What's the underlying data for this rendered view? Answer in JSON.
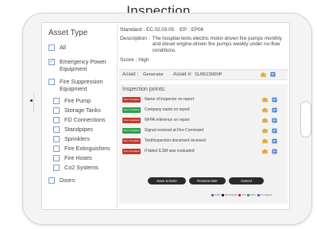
{
  "page_title": "Inspection",
  "sidebar": {
    "title": "Asset Type",
    "items": [
      {
        "label": "All",
        "checked": false
      },
      {
        "label": "Emergency Power Equipment",
        "checked": true
      },
      {
        "label": "Fire Suppression Equipment",
        "checked": false
      },
      {
        "label": "Fire Pump",
        "checked": false
      },
      {
        "label": "Storage Tanks",
        "checked": false
      },
      {
        "label": "FD Connections",
        "checked": false
      },
      {
        "label": "Standpipes",
        "checked": false
      },
      {
        "label": "Sprinklers",
        "checked": false
      },
      {
        "label": "Fire Extinguishers",
        "checked": false
      },
      {
        "label": "Fire Hoses",
        "checked": false
      },
      {
        "label": "Co2 Systems",
        "checked": false
      },
      {
        "label": "Doors",
        "checked": false
      }
    ]
  },
  "header": {
    "standard_label": "Standard :",
    "standard_value": "EC.02.03.05",
    "ep_label": "EP :",
    "ep_value": "EP06",
    "description_label": "Description :",
    "description_text": "The hospital tests electric motor-driven fire pumps monthly and diesel engine-driven fire pumps weekly under no-flow conditions.",
    "score_label": "Score :",
    "score_value": "High"
  },
  "asset": {
    "asset_label": "Asset :",
    "asset_value": "Generator",
    "asset_num_label": "Asset #:",
    "asset_num_value": "SU9523000P"
  },
  "inspection": {
    "title": "Inspection points:",
    "points": [
      {
        "status": "Non Compliant",
        "status_color": "#c0392b",
        "label": "Name of inspector on report"
      },
      {
        "status": "Non Compliant",
        "status_color": "#2e9e4f",
        "label": "Company name on report"
      },
      {
        "status": "Non Compliant",
        "status_color": "#c0392b",
        "label": "NFPA reference on report"
      },
      {
        "status": "Non Compliant",
        "status_color": "#2e9e4f",
        "label": "Signal received at Fire Command"
      },
      {
        "status": "Non Compliant",
        "status_color": "#c0392b",
        "label": "Test/inspection document received"
      },
      {
        "status": "Non Compliant",
        "status_color": "#c0392b",
        "label": "If failed ILSM was evaluated"
      }
    ]
  },
  "buttons": {
    "save": "Save & Done",
    "resume": "Resume later",
    "cancel": "Cancel"
  },
  "legend": [
    {
      "label": "ILSM",
      "color": "#3a78c8"
    },
    {
      "label": "Not Started",
      "color": "#222222"
    },
    {
      "label": "Fail",
      "color": "#d32f2f"
    },
    {
      "label": "Pass",
      "color": "#2e9e4f"
    },
    {
      "label": "In progress",
      "color": "#3a78c8"
    }
  ],
  "icons": {
    "camera": "camera-icon",
    "note": "note-icon"
  }
}
